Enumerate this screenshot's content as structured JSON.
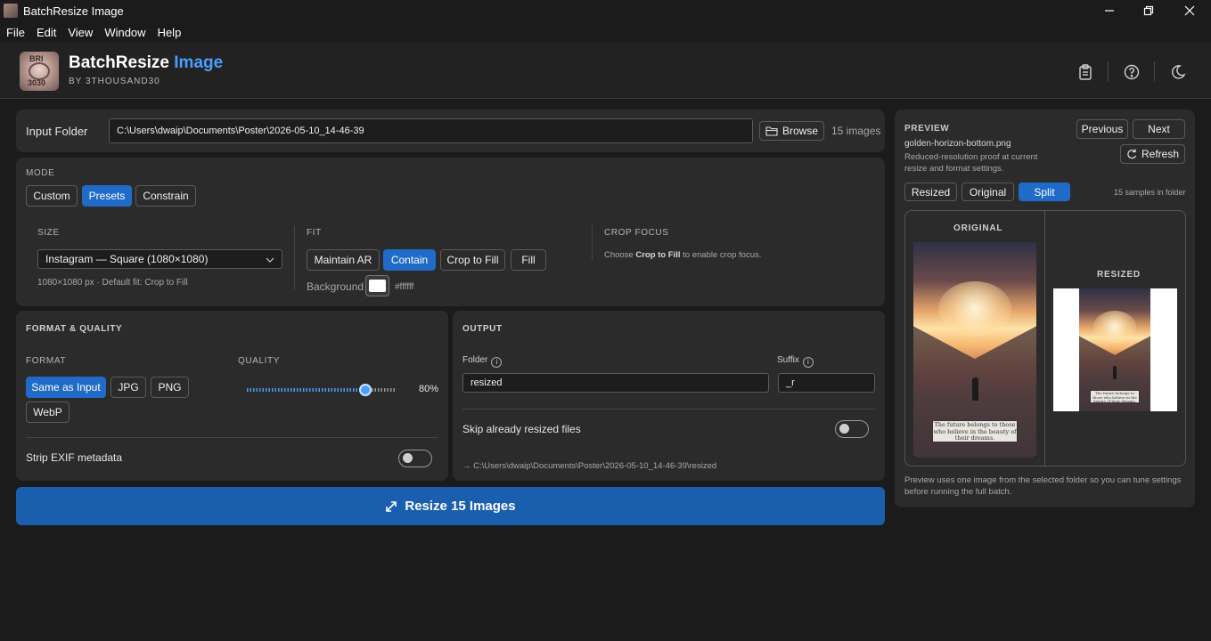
{
  "window": {
    "title": "BatchResize Image"
  },
  "menu": [
    "File",
    "Edit",
    "View",
    "Window",
    "Help"
  ],
  "header": {
    "logo_top": "BRI",
    "logo_bottom": "3030",
    "brand_main": "BatchResize",
    "brand_accent": "Image",
    "byline": "BY 3THOUSAND30",
    "icons": [
      "clipboard-icon",
      "help-icon",
      "moon-icon"
    ]
  },
  "input": {
    "label": "Input Folder",
    "path": "C:\\Users\\dwaip\\Documents\\Poster\\2026-05-10_14-46-39",
    "browse_label": "Browse",
    "count": "15 images"
  },
  "mode": {
    "title": "MODE",
    "options": [
      "Custom",
      "Presets",
      "Constrain"
    ],
    "selected": "Presets"
  },
  "size": {
    "title": "SIZE",
    "selected": "Instagram — Square (1080×1080)",
    "hint": "1080×1080 px  ·  Default fit: Crop to Fill"
  },
  "fit": {
    "title": "FIT",
    "options": [
      "Maintain AR",
      "Contain",
      "Crop to Fill",
      "Fill"
    ],
    "selected": "Contain",
    "background_label": "Background",
    "background_value": "#ffffff"
  },
  "crop_focus": {
    "title": "CROP FOCUS",
    "hint_pre": "Choose ",
    "hint_bold": "Crop to Fill",
    "hint_post": " to enable crop focus."
  },
  "format_quality": {
    "title": "FORMAT & QUALITY",
    "format_label": "FORMAT",
    "formats": [
      "Same as Input",
      "JPG",
      "PNG",
      "WebP"
    ],
    "selected_format": "Same as Input",
    "quality_label": "QUALITY",
    "quality_value": 80,
    "quality_text": "80%",
    "strip_exif_label": "Strip EXIF metadata",
    "strip_exif_on": false
  },
  "output": {
    "title": "OUTPUT",
    "folder_label": "Folder",
    "folder_value": "resized",
    "suffix_label": "Suffix",
    "suffix_value": "_r",
    "skip_label": "Skip already resized files",
    "skip_on": false,
    "path_preview": "→ C:\\Users\\dwaip\\Documents\\Poster\\2026-05-10_14-46-39\\resized"
  },
  "action": {
    "resize_label": "Resize 15 Images"
  },
  "preview": {
    "title": "PREVIEW",
    "filename": "golden-horizon-bottom.png",
    "description": "Reduced-resolution proof at current resize and format settings.",
    "previous_label": "Previous",
    "next_label": "Next",
    "refresh_label": "Refresh",
    "views": [
      "Resized",
      "Original",
      "Split"
    ],
    "selected_view": "Split",
    "samples": "15 samples in folder",
    "original_label": "ORIGINAL",
    "resized_label": "RESIZED",
    "caption_text": "The future belongs to those who believe in the beauty of their dreams.",
    "footer": "Preview uses one image from the selected folder so you can tune settings before running the full batch."
  },
  "colors": {
    "accent": "#1f6bc7",
    "brand_accent": "#4a9eff",
    "action": "#1a5fae",
    "background": "#1b1b1b",
    "panel": "#2b2b2b"
  }
}
